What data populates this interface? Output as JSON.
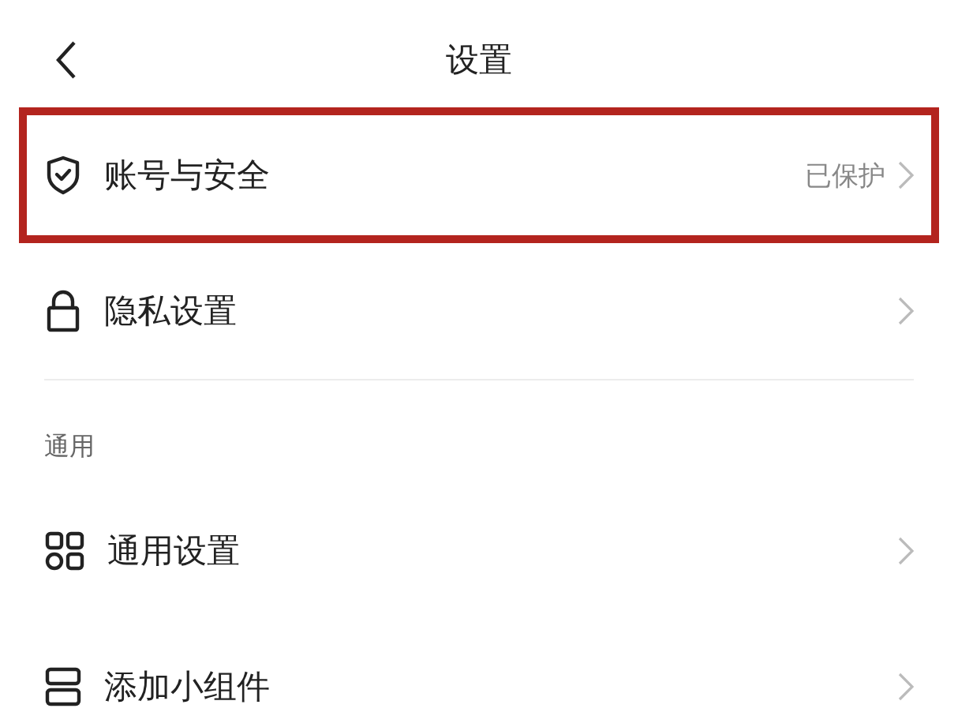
{
  "header": {
    "title": "设置"
  },
  "groups": [
    {
      "items": [
        {
          "kind": "shield",
          "label": "账号与安全",
          "value": "已保护",
          "highlighted": true
        },
        {
          "kind": "lock",
          "label": "隐私设置",
          "highlighted": false
        }
      ]
    },
    {
      "title": "通用",
      "items": [
        {
          "kind": "grid",
          "label": "通用设置",
          "highlighted": false
        },
        {
          "kind": "widget",
          "label": "添加小组件",
          "highlighted": false
        }
      ]
    }
  ]
}
